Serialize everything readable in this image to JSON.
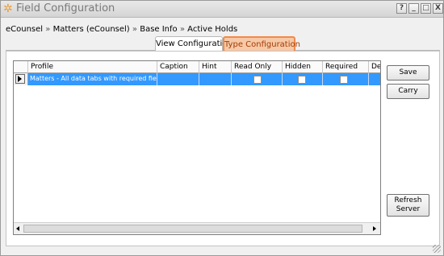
{
  "window": {
    "title": "Field Configuration",
    "title_icon": "gear-icon",
    "controls": {
      "help": "?",
      "minimize": "_",
      "maximize": "□",
      "close": "X"
    }
  },
  "breadcrumb": [
    "eCounsel",
    "Matters (eCounsel)",
    "Base Info",
    "Active Holds"
  ],
  "breadcrumb_sep": "»",
  "tabs": [
    {
      "label": "View Configuration",
      "active": false
    },
    {
      "label": "Type Configuration",
      "active": true
    }
  ],
  "grid": {
    "columns": [
      "Profile",
      "Caption",
      "Hint",
      "Read Only",
      "Hidden",
      "Required",
      "De"
    ],
    "rows": [
      {
        "profile": "Matters - All data tabs with required fields",
        "caption": "",
        "hint": "",
        "read_only": false,
        "hidden": false,
        "required": false,
        "selected": true
      }
    ]
  },
  "buttons": {
    "save": "Save",
    "carry": "Carry",
    "refresh": "Refresh\nServer"
  },
  "colors": {
    "selection": "#3399ff",
    "active_tab_fill": "#f7c9a6",
    "active_tab_border": "#f08a4b"
  }
}
